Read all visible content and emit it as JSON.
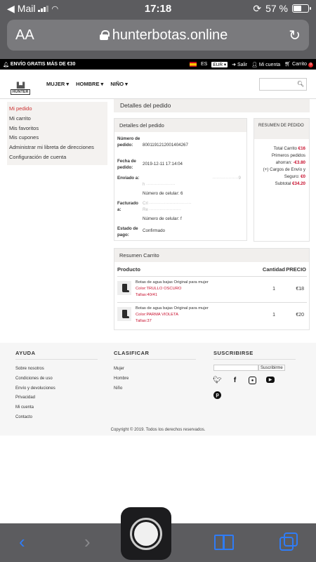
{
  "ios": {
    "carrier": "Mail",
    "time": "17:18",
    "battery_pct": "57 %",
    "battery_level": 0.57,
    "aa_label": "AA",
    "url": "hunterbotas.online",
    "reload_icon": "reload-icon"
  },
  "promo": {
    "free_shipping": "ENVÍO GRATIS MÁS DE €30",
    "lang": "ES",
    "currency": "EUR",
    "exit": "Salir",
    "account": "Mi cuenta",
    "cart": "Carrito",
    "cart_count": "0"
  },
  "header": {
    "logo_text": "HUNTER",
    "nav": [
      "MUJER",
      "HOMBRE",
      "NIÑO"
    ]
  },
  "sidebar": {
    "items": [
      "Mi pedido",
      "Mi carrito",
      "Mis favoritos",
      "Mis cupones",
      "Administrar mi libreta de direcciones",
      "Configuración de cuenta"
    ]
  },
  "main": {
    "title": "Detalles del pedido",
    "details": {
      "box_title": "Detalles del pedido",
      "order_number_label": "Número de pedido:",
      "order_number": "8001191212001404267",
      "date_label": "Fecha de pedido:",
      "date": "2019-12-11 17:14:04",
      "shipped_label": "Enviado a:",
      "shipped_blur": "9",
      "shipped_blur2": "h",
      "shipped_phone": "Número de celular: 6",
      "billed_label": "Facturado a:",
      "billed_blur": "Cri",
      "billed_blur2": "Re",
      "billed_phone": "Número de celular: f",
      "status_label": "Estado de pago:",
      "status": "Confirmado"
    },
    "summary": {
      "box_title": "RESUMEN DE PEDIDO",
      "total_label": "Total Carrito",
      "total": "€16",
      "discount_label": "Primeros pedidos ahorran:",
      "discount": "-€3.80",
      "shipping_label": "(+) Cargos de Envío y Seguro:",
      "shipping": "€0",
      "subtotal_label": "Subtotal",
      "subtotal": "€34.20"
    },
    "cart": {
      "box_title": "Resumen Carrito",
      "col_product": "Producto",
      "col_qty": "Cantidad",
      "col_price": "PRECIO",
      "items": [
        {
          "name": "Botas de agua bajas Original para mujer",
          "color": "Color:TRULLO OSCURO",
          "size": "Tallas:40/41",
          "qty": "1",
          "price": "€18"
        },
        {
          "name": "Botas de agua bajas Original para mujer",
          "color": "Color:PARMA VIOLETA",
          "size": "Tallas:37",
          "qty": "1",
          "price": "€20"
        }
      ]
    }
  },
  "footer": {
    "help_title": "AYUDA",
    "help_links": [
      "Sobre nosotros",
      "Condiciones de uso",
      "Envío y devoluciones",
      "Privacidad",
      "Mi cuenta",
      "Contacto"
    ],
    "classify_title": "CLASIFICAR",
    "classify_links": [
      "Mujer",
      "Hombre",
      "Niño"
    ],
    "subscribe_title": "SUSCRIBIRSE",
    "subscribe_button": "Suscribirme",
    "social_icons": [
      "twitter-icon",
      "facebook-icon",
      "instagram-icon",
      "youtube-icon",
      "pinterest-icon"
    ],
    "copyright": "Copyright © 2019. Todos los derechos reservados."
  },
  "colors": {
    "accent_red": "#c8102e",
    "ios_blue": "#2f7cf6"
  }
}
